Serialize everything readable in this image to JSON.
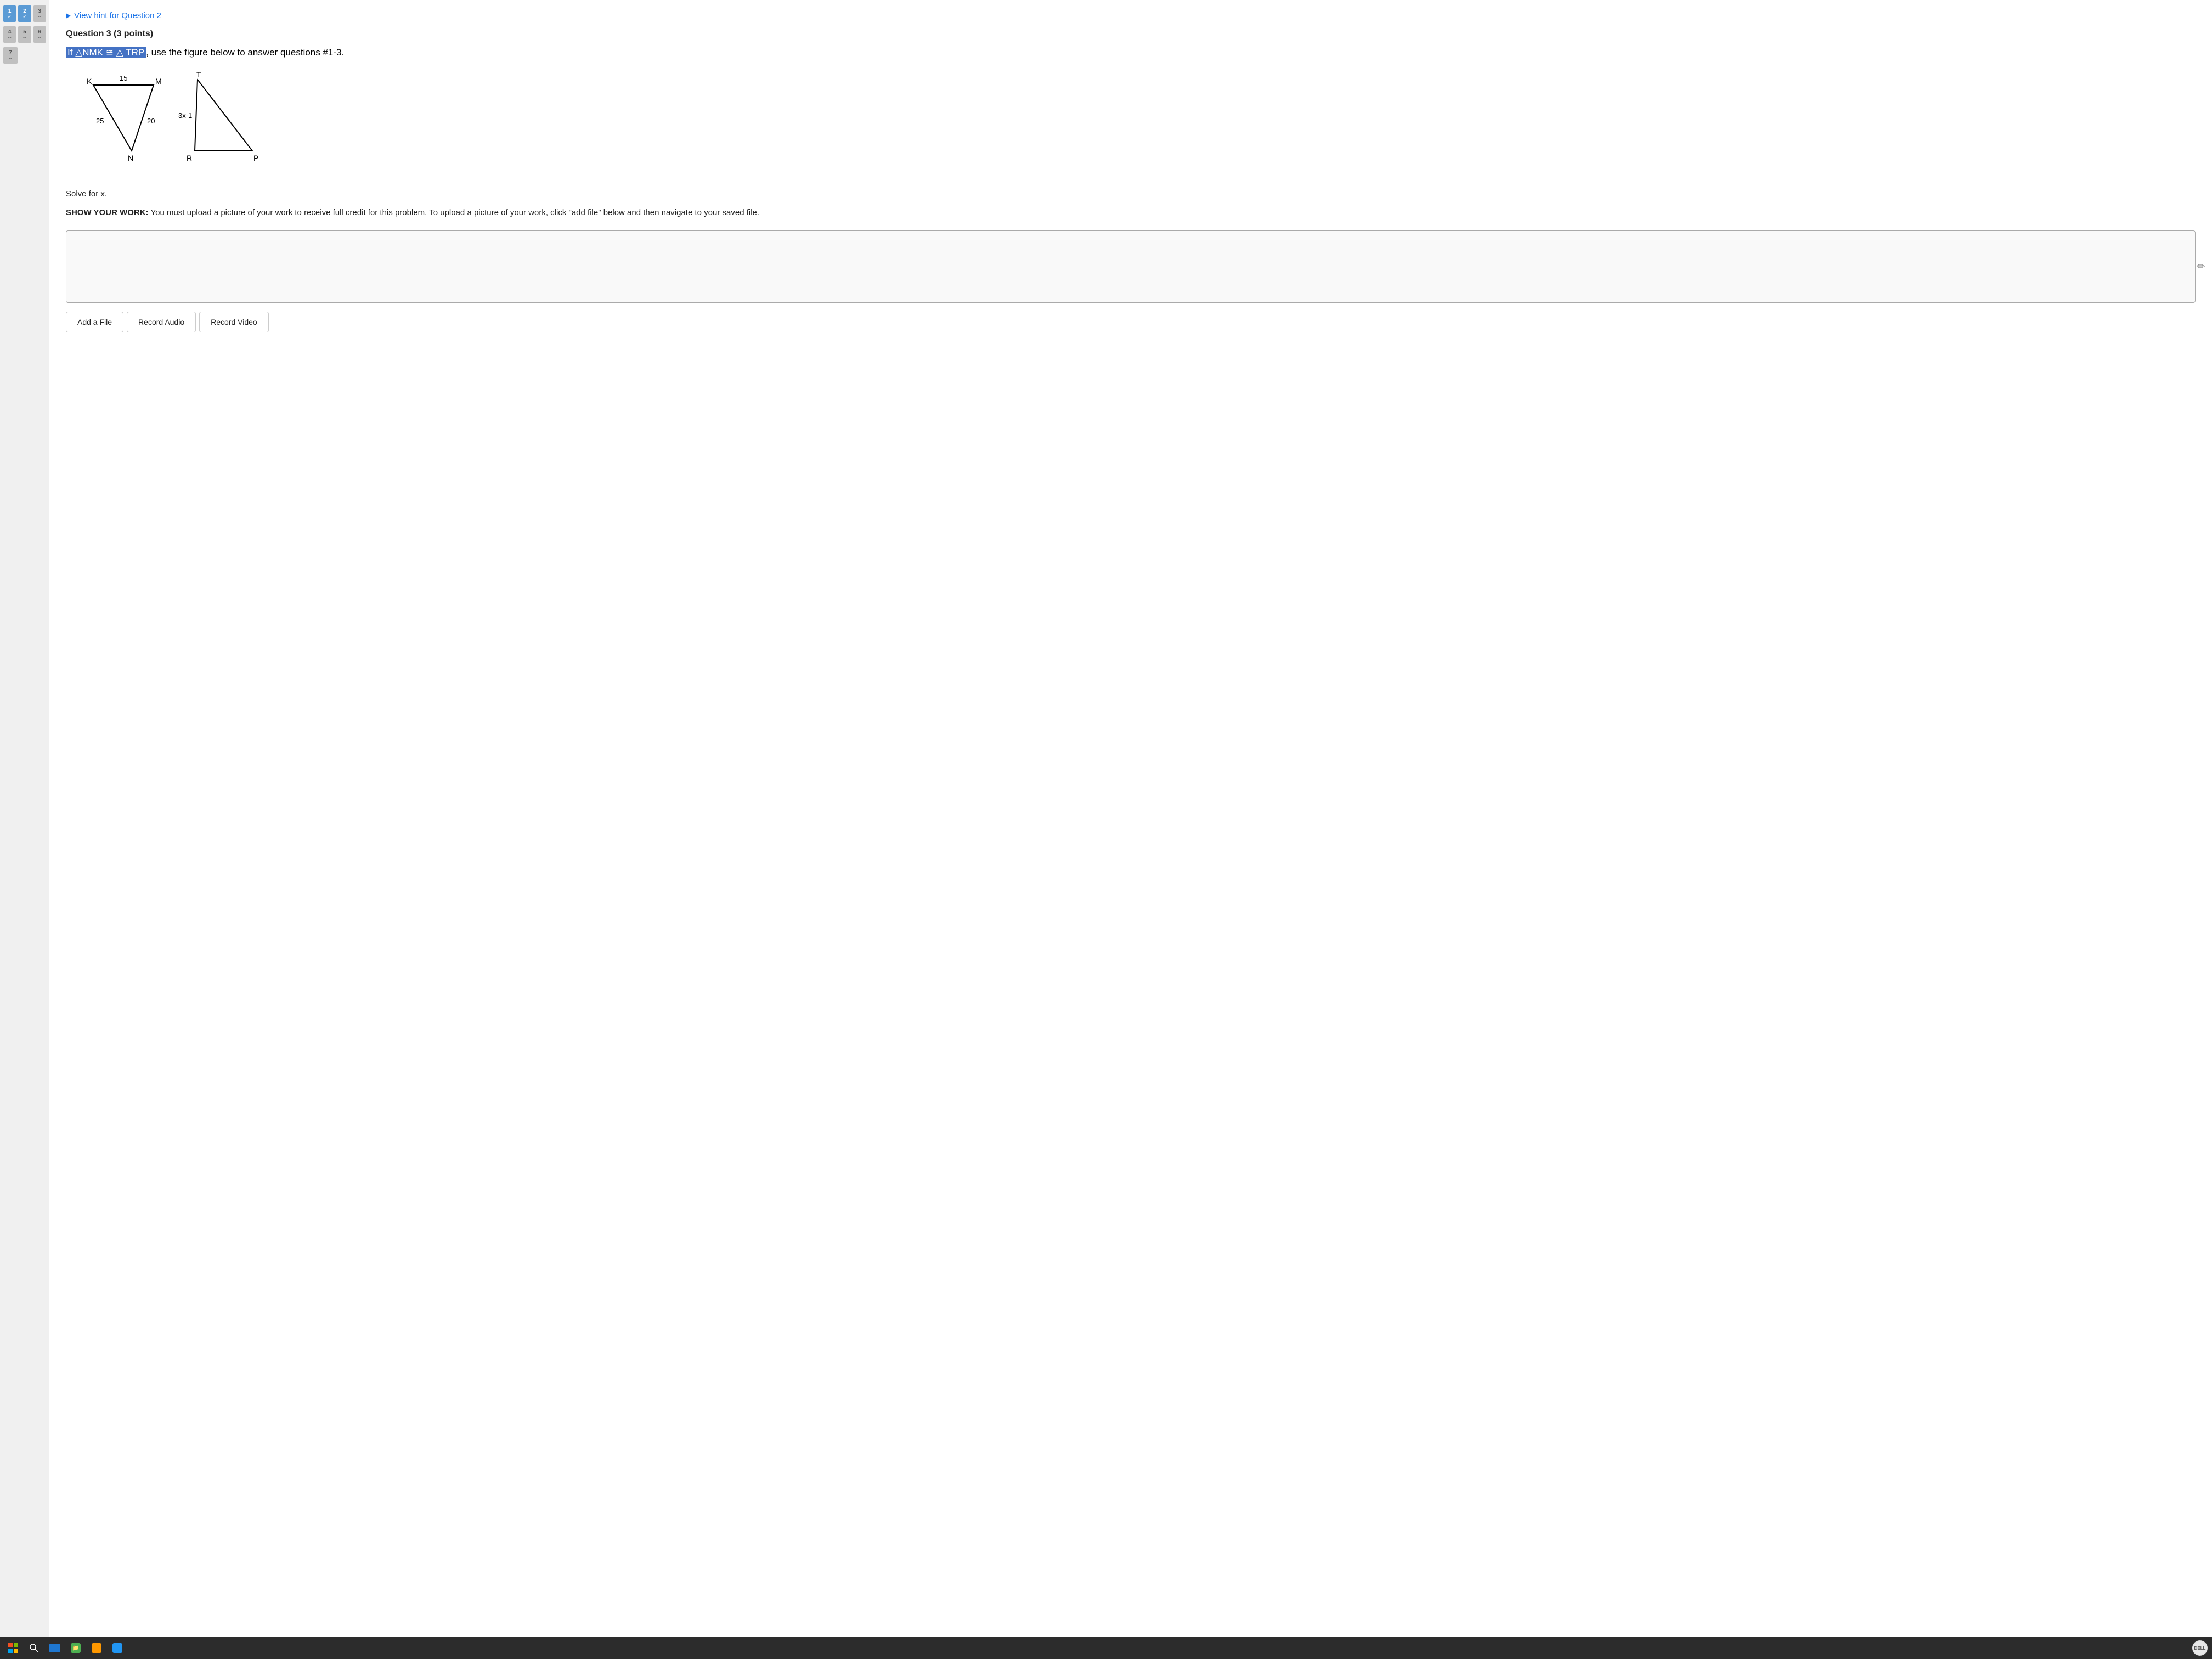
{
  "sidebar": {
    "items": [
      {
        "num": "1",
        "status": "check",
        "row": 1
      },
      {
        "num": "2",
        "status": "check",
        "row": 1
      },
      {
        "num": "3",
        "status": "dashes",
        "row": 1
      },
      {
        "num": "4",
        "status": "dashes",
        "row": 2
      },
      {
        "num": "5",
        "status": "dashes",
        "row": 2
      },
      {
        "num": "6",
        "status": "dashes",
        "row": 2
      },
      {
        "num": "7",
        "status": "dashes",
        "row": 3
      }
    ]
  },
  "hint": {
    "label": "View hint for Question 2"
  },
  "question": {
    "header": "Question 3 (3 points)",
    "statement_prefix": "If △NMK ≅ △ TRP",
    "statement_suffix": ", use the figure below to answer questions #1-3.",
    "figure": {
      "triangle1": {
        "label_k": "K",
        "label_m": "M",
        "label_n": "N",
        "side_km": "15",
        "side_kn": "25",
        "side_mn": "20"
      },
      "triangle2": {
        "label_t": "T",
        "label_r": "R",
        "label_p": "P",
        "side_tr": "3x-1"
      }
    },
    "solve_text": "Solve for x.",
    "show_work_text": "SHOW YOUR WORK: You must upload a picture of your work to receive full credit for this problem. To upload a picture of your work, click \"add file\" below and then navigate to your saved file."
  },
  "buttons": {
    "add_file": "Add a File",
    "record_audio": "Record Audio",
    "record_video": "Record Video"
  },
  "taskbar": {
    "dell_label": "DELL"
  }
}
